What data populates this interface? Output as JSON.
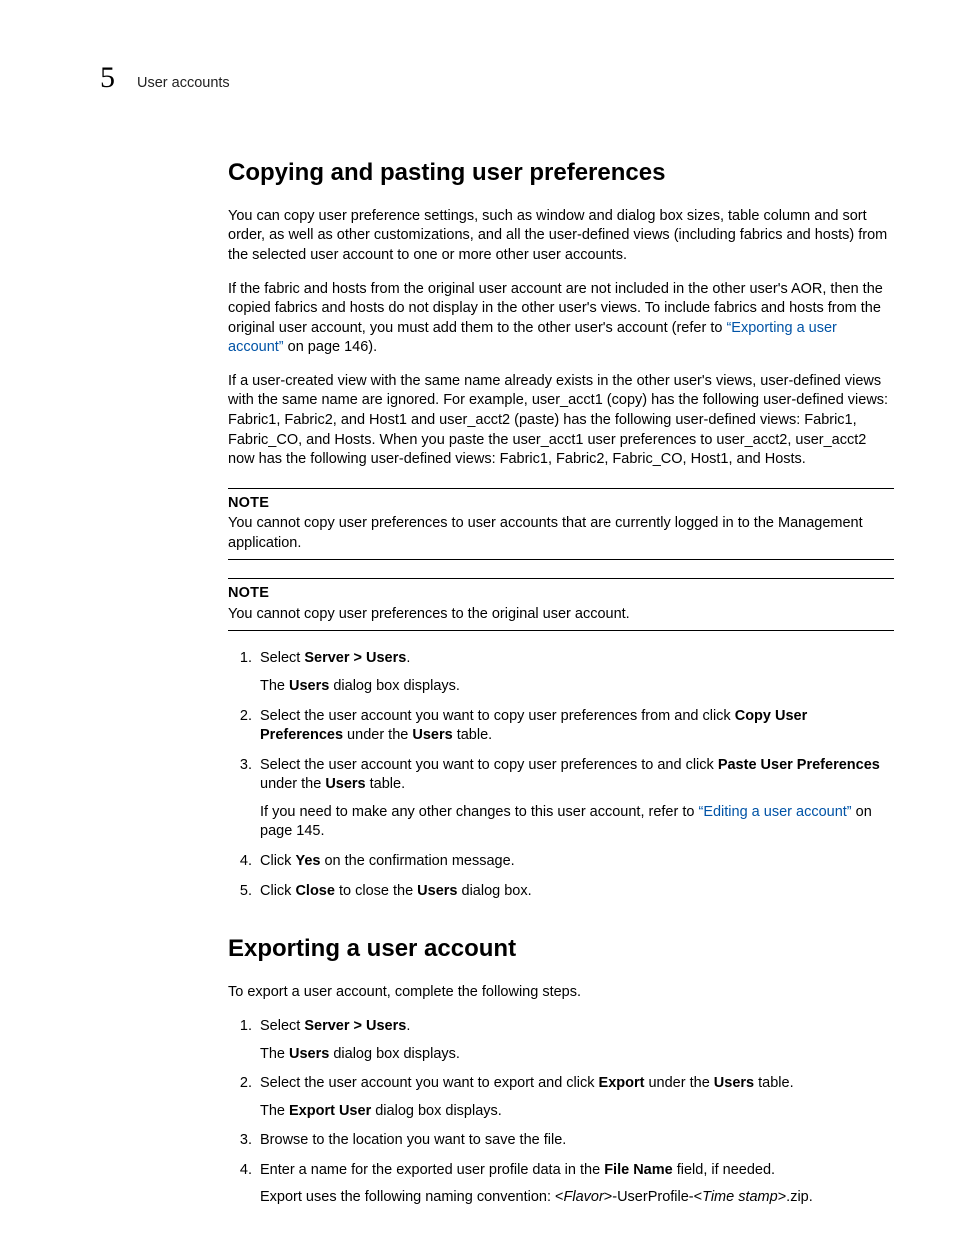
{
  "header": {
    "chapnum": "5",
    "chaptitle": "User accounts"
  },
  "s1": {
    "heading": "Copying and pasting user preferences",
    "p1": "You can copy user preference settings, such as window and dialog box sizes, table column and sort order, as well as other customizations, and all the user-defined views (including fabrics and hosts) from the selected user account to one or more other user accounts.",
    "p2a": "If the fabric and hosts from the original user account are not included in the other user's AOR, then the copied fabrics and hosts do not display in the other user's views. To include fabrics and hosts from the original user account, you must add them to the other user's account (refer to ",
    "p2link": "“Exporting a user account”",
    "p2b": " on page 146).",
    "p3": "If a user-created view with the same name already exists in the other user's views, user-defined views with the same name are ignored. For example, user_acct1 (copy) has the following user-defined views: Fabric1, Fabric2, and Host1 and user_acct2 (paste) has the following user-defined views: Fabric1, Fabric_CO, and Hosts. When you paste the user_acct1 user preferences to user_acct2, user_acct2 now has the following user-defined views: Fabric1, Fabric2, Fabric_CO, Host1, and Hosts.",
    "note1_label": "NOTE",
    "note1_text": "You cannot copy user preferences to user accounts that are currently logged in to the Management application.",
    "note2_label": "NOTE",
    "note2_text": "You cannot copy user preferences to the original user account.",
    "ol": {
      "i1a": "Select ",
      "i1b": "Server > Users",
      "i1c": ".",
      "i1p_a": "The ",
      "i1p_b": "Users",
      "i1p_c": " dialog box displays.",
      "i2a": "Select the user account you want to copy user preferences from and click ",
      "i2b": "Copy User Preferences",
      "i2c": " under the ",
      "i2d": "Users",
      "i2e": " table.",
      "i3a": "Select the user account you want to copy user preferences to and click ",
      "i3b": "Paste User Preferences",
      "i3c": " under the ",
      "i3d": "Users",
      "i3e": " table.",
      "i3p_a": "If you need to make any other changes to this user account, refer to ",
      "i3p_link": "“Editing a user account”",
      "i3p_b": " on page 145.",
      "i4a": "Click ",
      "i4b": "Yes",
      "i4c": " on the confirmation message.",
      "i5a": "Click ",
      "i5b": "Close",
      "i5c": " to close the ",
      "i5d": "Users",
      "i5e": " dialog box."
    }
  },
  "s2": {
    "heading": "Exporting a user account",
    "p1": "To export a user account, complete the following steps.",
    "ol": {
      "i1a": "Select ",
      "i1b": "Server > Users",
      "i1c": ".",
      "i1p_a": "The ",
      "i1p_b": "Users",
      "i1p_c": " dialog box displays.",
      "i2a": "Select the user account you want to export and click ",
      "i2b": "Export",
      "i2c": " under the ",
      "i2d": "Users",
      "i2e": " table.",
      "i2p_a": "The ",
      "i2p_b": "Export User",
      "i2p_c": " dialog box displays.",
      "i3": "Browse to the location you want to save the file.",
      "i4a": "Enter a name for the exported user profile data in the ",
      "i4b": "File Name",
      "i4c": " field, if needed.",
      "i4p_a": "Export uses the following naming convention: <",
      "i4p_b": "Flavor",
      "i4p_c": ">-UserProfile-<",
      "i4p_d": "Time stamp",
      "i4p_e": ">.zip."
    }
  }
}
